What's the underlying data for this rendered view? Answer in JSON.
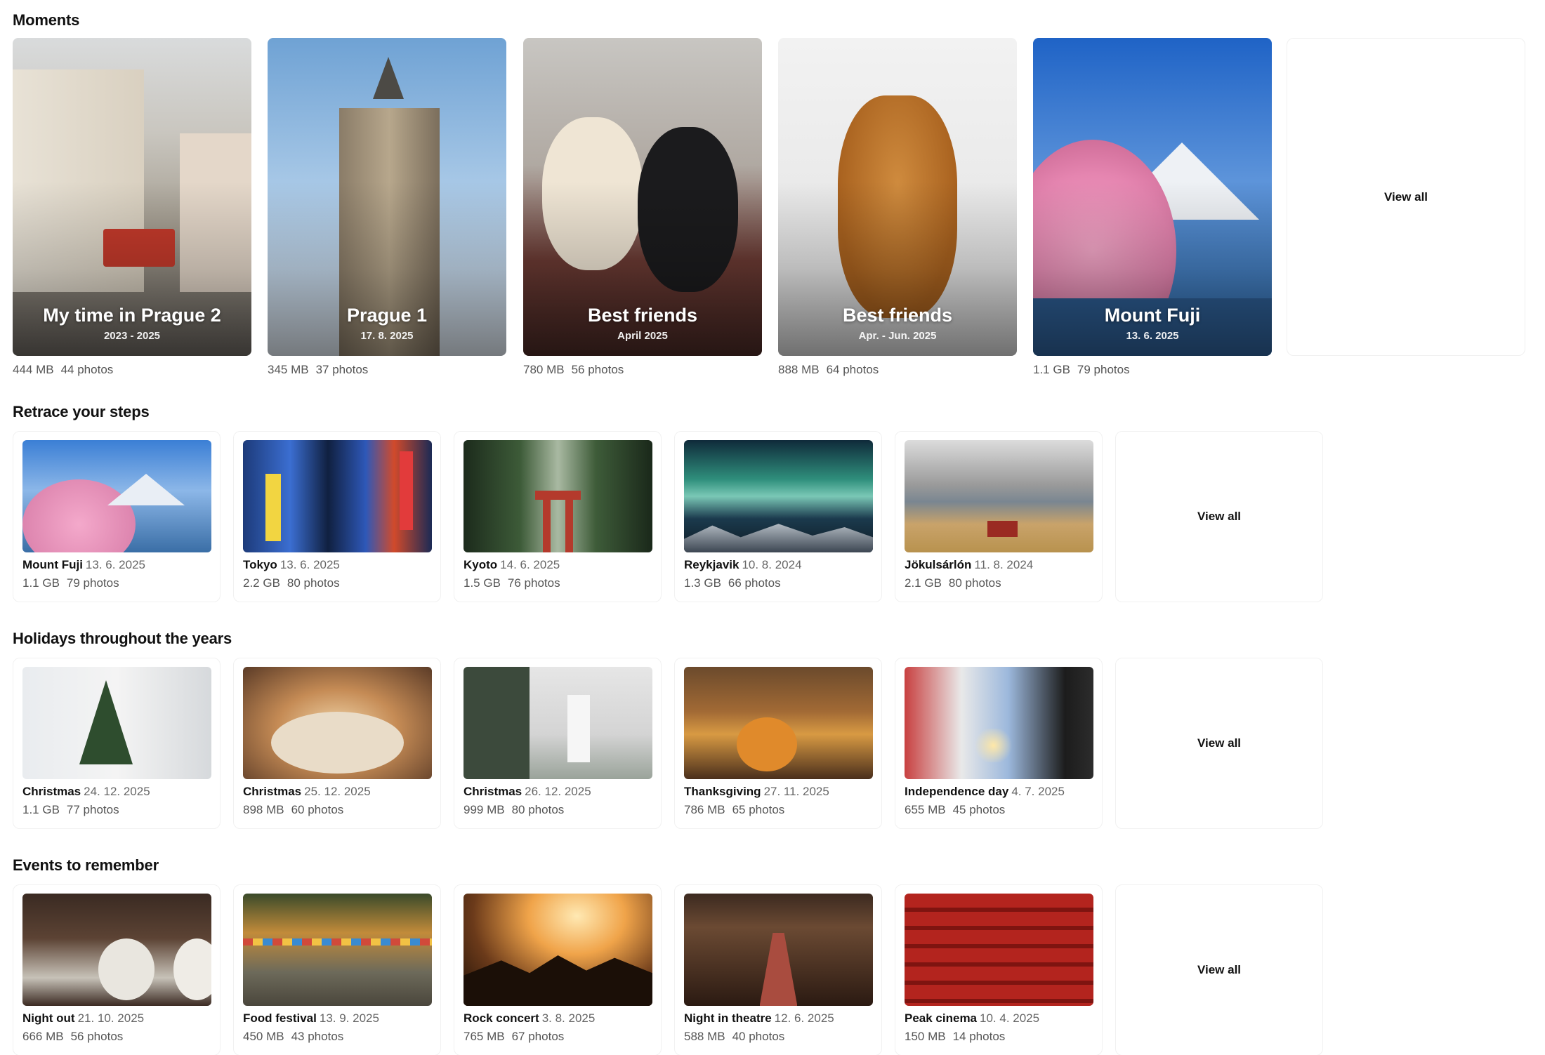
{
  "sections": {
    "moments": "Moments",
    "retrace": "Retrace your steps",
    "holidays": "Holidays throughout the years",
    "events": "Events to remember"
  },
  "view_all": "View all",
  "moments": [
    {
      "title": "My time in Prague 2",
      "subtitle": "2023 - 2025",
      "size": "444 MB",
      "photos": "44 photos"
    },
    {
      "title": "Prague 1",
      "subtitle": "17. 8. 2025",
      "size": "345 MB",
      "photos": "37 photos"
    },
    {
      "title": "Best friends",
      "subtitle": "April 2025",
      "size": "780 MB",
      "photos": "56 photos"
    },
    {
      "title": "Best friends",
      "subtitle": "Apr. - Jun. 2025",
      "size": "888 MB",
      "photos": "64 photos"
    },
    {
      "title": "Mount Fuji",
      "subtitle": "13. 6. 2025",
      "size": "1.1 GB",
      "photos": "79 photos"
    }
  ],
  "retrace": [
    {
      "name": "Mount Fuji",
      "date": "13. 6. 2025",
      "size": "1.1 GB",
      "photos": "79 photos"
    },
    {
      "name": "Tokyo",
      "date": "13. 6. 2025",
      "size": "2.2 GB",
      "photos": "80 photos"
    },
    {
      "name": "Kyoto",
      "date": "14. 6. 2025",
      "size": "1.5 GB",
      "photos": "76 photos"
    },
    {
      "name": "Reykjavik",
      "date": "10. 8. 2024",
      "size": "1.3 GB",
      "photos": "66 photos"
    },
    {
      "name": "Jökulsárlón",
      "date": "11. 8. 2024",
      "size": "2.1 GB",
      "photos": "80 photos"
    }
  ],
  "holidays": [
    {
      "name": "Christmas",
      "date": "24. 12. 2025",
      "size": "1.1 GB",
      "photos": "77 photos"
    },
    {
      "name": "Christmas",
      "date": "25. 12. 2025",
      "size": "898 MB",
      "photos": "60 photos"
    },
    {
      "name": "Christmas",
      "date": "26. 12. 2025",
      "size": "999 MB",
      "photos": "80 photos"
    },
    {
      "name": "Thanksgiving",
      "date": "27. 11. 2025",
      "size": "786 MB",
      "photos": "65 photos"
    },
    {
      "name": "Independence day",
      "date": "4. 7. 2025",
      "size": "655 MB",
      "photos": "45 photos"
    }
  ],
  "events": [
    {
      "name": "Night out",
      "date": "21. 10. 2025",
      "size": "666 MB",
      "photos": "56 photos"
    },
    {
      "name": "Food festival",
      "date": "13. 9. 2025",
      "size": "450 MB",
      "photos": "43 photos"
    },
    {
      "name": "Rock concert",
      "date": "3. 8. 2025",
      "size": "765 MB",
      "photos": "67 photos"
    },
    {
      "name": "Night in theatre",
      "date": "12. 6. 2025",
      "size": "588 MB",
      "photos": "40 photos"
    },
    {
      "name": "Peak cinema",
      "date": "10. 4. 2025",
      "size": "150 MB",
      "photos": "14 photos"
    }
  ]
}
